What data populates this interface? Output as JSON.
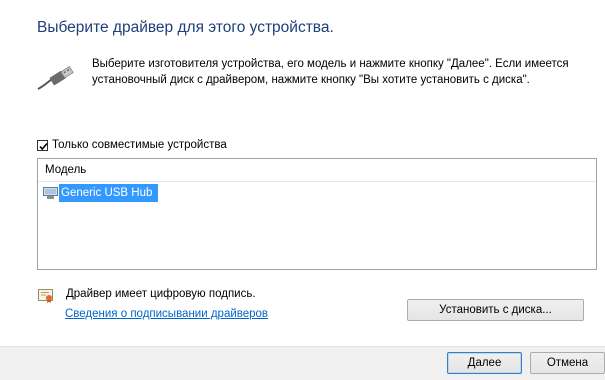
{
  "title": "Выберите драйвер для этого устройства.",
  "instructions": "Выберите изготовителя устройства, его модель и нажмите кнопку \"Далее\". Если имеется установочный диск с  драйвером, нажмите кнопку \"Вы хотите установить с диска\".",
  "compatible": {
    "label": "Только совместимые устройства",
    "checked": true
  },
  "model_list": {
    "header": "Модель",
    "items": [
      {
        "label": "Generic USB Hub",
        "selected": true
      }
    ]
  },
  "signature": {
    "text": "Драйвер имеет цифровую подпись.",
    "link": "Сведения о подписывании драйверов"
  },
  "buttons": {
    "install_from_disk": "Установить с диска...",
    "next": "Далее",
    "cancel": "Отмена"
  },
  "icons": {
    "device": "usb-plug-icon",
    "list_item": "usb-hub-icon",
    "signature": "certificate-icon"
  },
  "colors": {
    "title": "#1e3f7a",
    "selection": "#3399ff",
    "link": "#0066cc"
  }
}
